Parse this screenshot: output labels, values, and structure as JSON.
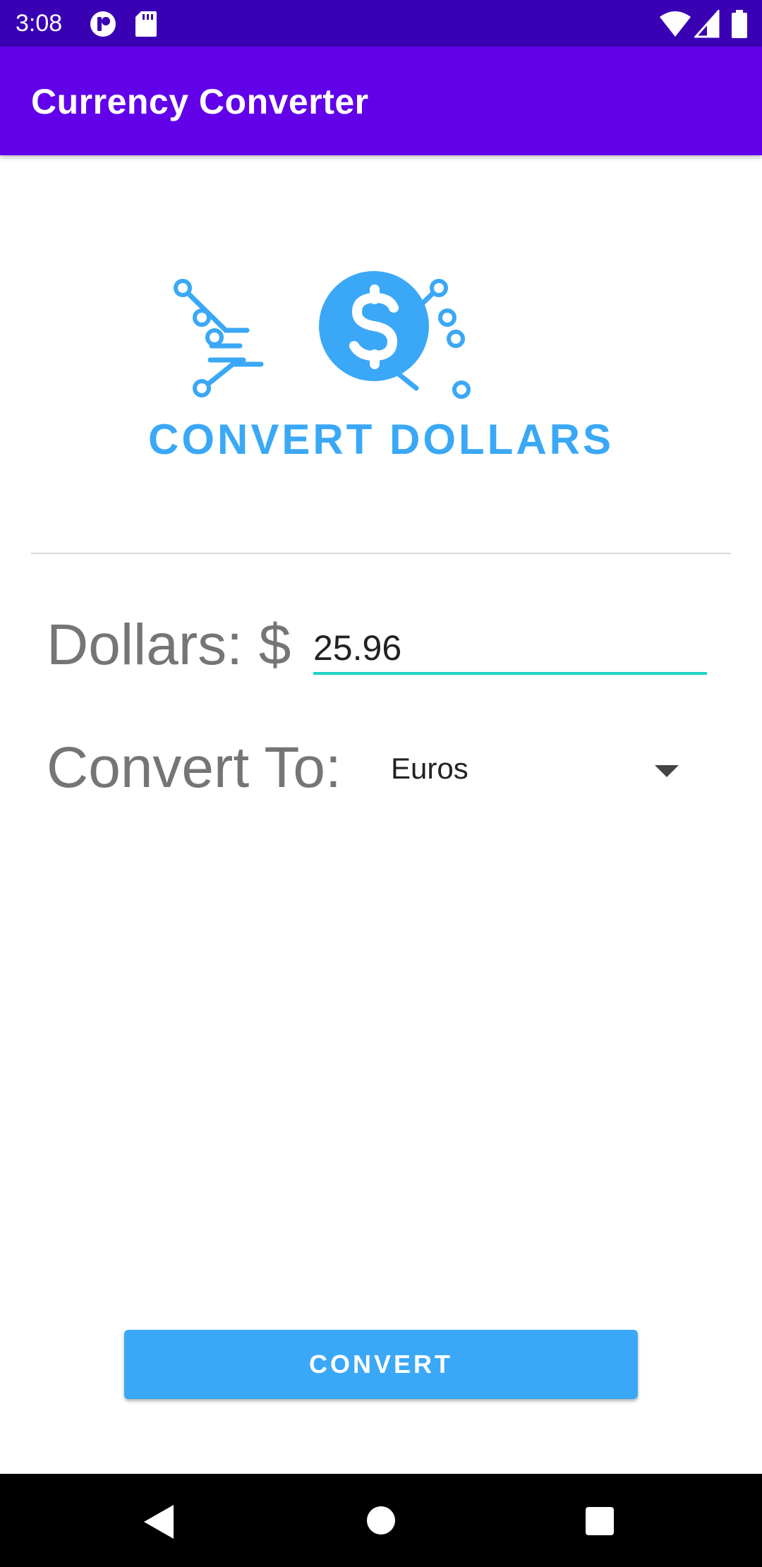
{
  "status_bar": {
    "time": "3:08",
    "icons": [
      "notification-app-icon",
      "sd-card-icon",
      "wifi-icon",
      "cell-signal-icon",
      "battery-icon"
    ],
    "background": "#3a00b4"
  },
  "app_bar": {
    "title": "Currency Converter",
    "background": "#6200ea"
  },
  "logo": {
    "text": "CONVERT DOLLARS",
    "icon": "dollar-circuit-logo",
    "color": "#3aa8f6"
  },
  "form": {
    "dollars_label": "Dollars: $",
    "dollars_value": "25.96",
    "convert_to_label": "Convert To:",
    "selected_currency": "Euros",
    "underline_color": "#1ed3c4"
  },
  "actions": {
    "convert_label": "CONVERT",
    "button_color": "#3aa8f6"
  },
  "nav_bar": {
    "icons": [
      "back-icon",
      "home-icon",
      "recents-icon"
    ]
  }
}
